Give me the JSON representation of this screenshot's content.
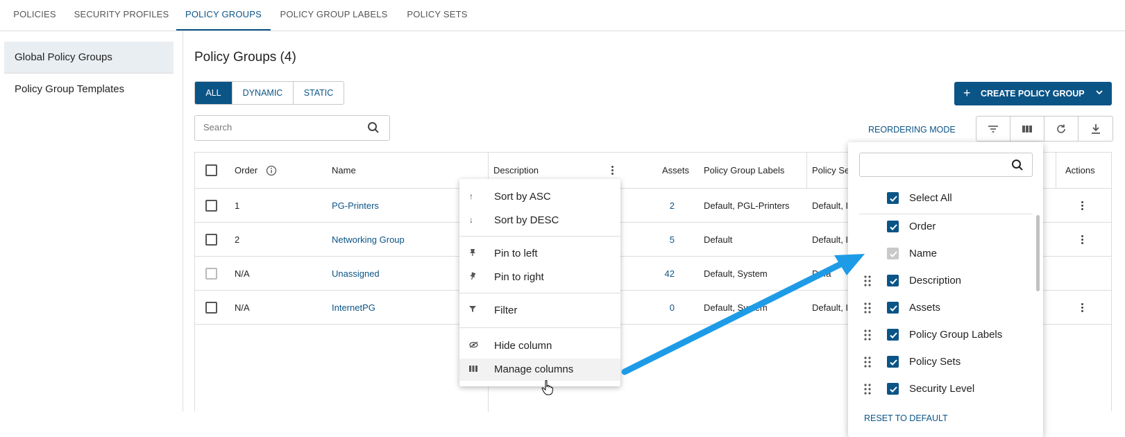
{
  "tabs": [
    {
      "label": "POLICIES",
      "active": false
    },
    {
      "label": "SECURITY PROFILES",
      "active": false
    },
    {
      "label": "POLICY GROUPS",
      "active": true
    },
    {
      "label": "POLICY GROUP LABELS",
      "active": false
    },
    {
      "label": "POLICY SETS",
      "active": false
    }
  ],
  "sidebar": {
    "items": [
      {
        "label": "Global Policy Groups",
        "active": true
      },
      {
        "label": "Policy Group Templates",
        "active": false
      }
    ]
  },
  "main": {
    "title": "Policy Groups (4)",
    "filters": [
      "ALL",
      "DYNAMIC",
      "STATIC"
    ],
    "search_placeholder": "Search",
    "create_label": "CREATE POLICY GROUP",
    "reordering_label": "REORDERING MODE"
  },
  "table": {
    "columns": [
      "Order",
      "Name",
      "Description",
      "Assets",
      "Policy Group Labels",
      "Policy Se",
      "Actions"
    ],
    "rows": [
      {
        "order": "1",
        "name": "PG-Printers",
        "assets": "2",
        "labels": "Default, PGL-Printers",
        "sets": "Default, I",
        "actions": true
      },
      {
        "order": "2",
        "name": "Networking Group",
        "assets": "5",
        "labels": "Default",
        "sets": "Default, I",
        "actions": true
      },
      {
        "order": "N/A",
        "name": "Unassigned",
        "assets": "42",
        "labels": "Default, System",
        "sets": "Defa",
        "actions": false
      },
      {
        "order": "N/A",
        "name": "InternetPG",
        "assets": "0",
        "labels": "Default, System",
        "sets": "Default, I",
        "actions": true
      }
    ]
  },
  "context_menu": {
    "items": [
      {
        "icon": "arrow-up-icon",
        "label": "Sort by ASC"
      },
      {
        "icon": "arrow-down-icon",
        "label": "Sort by DESC"
      },
      {
        "icon": "pin-left-icon",
        "label": "Pin to left"
      },
      {
        "icon": "pin-right-icon",
        "label": "Pin to right"
      },
      {
        "icon": "filter-icon",
        "label": "Filter"
      },
      {
        "icon": "eye-off-icon",
        "label": "Hide column"
      },
      {
        "icon": "columns-icon",
        "label": "Manage columns"
      }
    ]
  },
  "columns_panel": {
    "select_all": "Select All",
    "items": [
      {
        "label": "Order",
        "checked": true,
        "disabled": false,
        "draggable": false
      },
      {
        "label": "Name",
        "checked": true,
        "disabled": true,
        "draggable": false
      },
      {
        "label": "Description",
        "checked": true,
        "disabled": false,
        "draggable": true
      },
      {
        "label": "Assets",
        "checked": true,
        "disabled": false,
        "draggable": true
      },
      {
        "label": "Policy Group Labels",
        "checked": true,
        "disabled": false,
        "draggable": true
      },
      {
        "label": "Policy Sets",
        "checked": true,
        "disabled": false,
        "draggable": true
      },
      {
        "label": "Security Level",
        "checked": true,
        "disabled": false,
        "draggable": true
      }
    ],
    "reset_label": "RESET TO DEFAULT"
  },
  "colors": {
    "primary": "#0b5486",
    "annotation_arrow": "#1e9be6"
  }
}
